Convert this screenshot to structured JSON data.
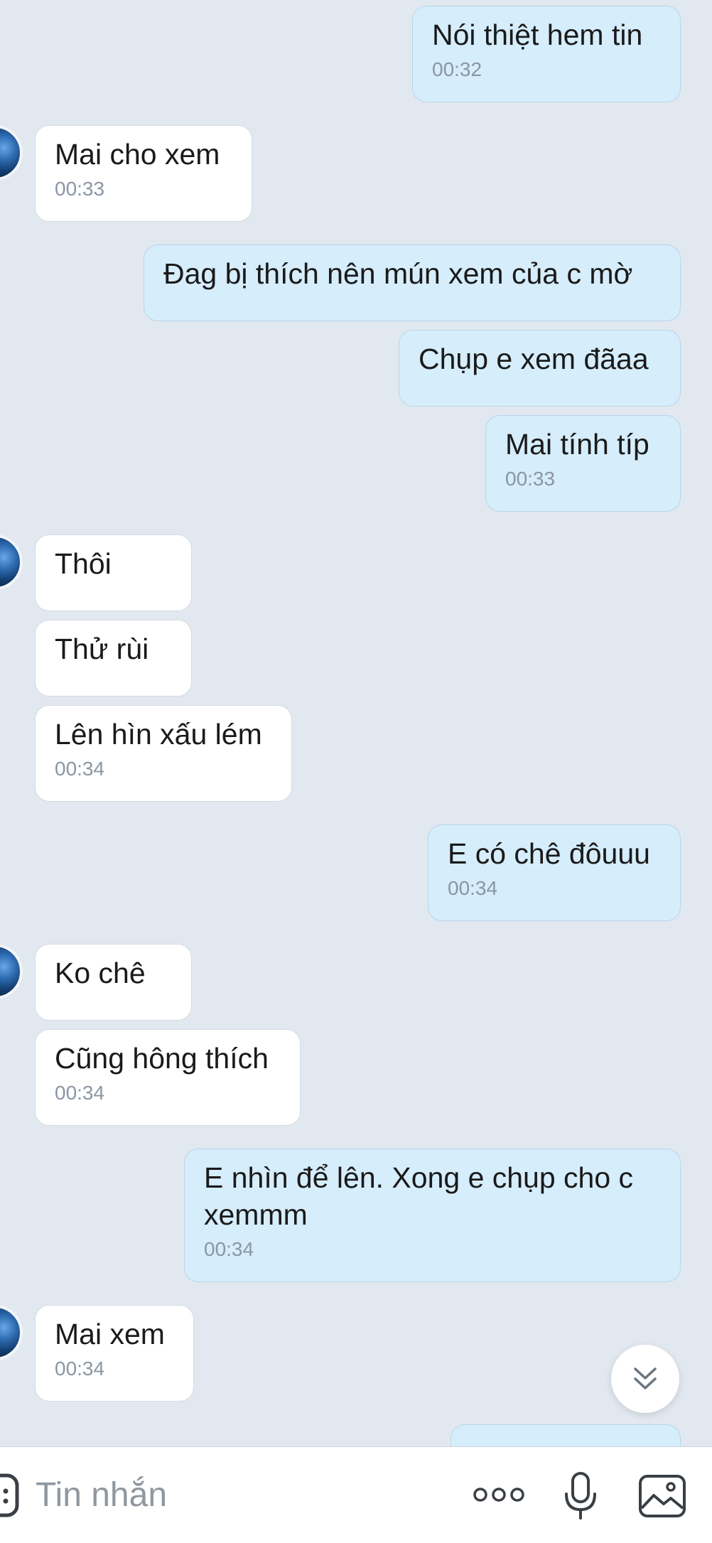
{
  "messages": [
    {
      "dir": "out",
      "text": "Nói thiệt hem tin",
      "time": "00:32"
    },
    {
      "dir": "in",
      "text": "Mai cho xem",
      "time": "00:33"
    },
    {
      "dir": "out",
      "text": "Đag bị thích nên mún xem của c mờ",
      "time": ""
    },
    {
      "dir": "out",
      "text": "Chụp e xem đãaa",
      "time": ""
    },
    {
      "dir": "out",
      "text": "Mai tính típ",
      "time": "00:33"
    },
    {
      "dir": "in",
      "text": "Thôi",
      "time": ""
    },
    {
      "dir": "in",
      "text": "Thử rùi",
      "time": ""
    },
    {
      "dir": "in",
      "text": "Lên hìn xấu lém",
      "time": "00:34"
    },
    {
      "dir": "out",
      "text": "E có chê đôuuu",
      "time": "00:34"
    },
    {
      "dir": "in",
      "text": "Ko chê",
      "time": ""
    },
    {
      "dir": "in",
      "text": "Cũng hông thích",
      "time": "00:34"
    },
    {
      "dir": "out",
      "text": "E nhìn để lên. Xong e chụp cho c xemmm",
      "time": "00:34"
    },
    {
      "dir": "in",
      "text": "Mai xem",
      "time": "00:34"
    },
    {
      "dir": "out",
      "text": "",
      "time": ""
    }
  ],
  "input": {
    "placeholder": "Tin nhắn"
  },
  "icons": {
    "sticker": "sticker-icon",
    "more": "more-options-icon",
    "mic": "microphone-icon",
    "gallery": "image-gallery-icon",
    "scroll": "scroll-to-bottom-icon",
    "avatar": "contact-avatar"
  },
  "colors": {
    "background": "#e2e8f0",
    "incoming_bubble": "#ffffff",
    "outgoing_bubble": "#d6edfb",
    "timestamp": "#8a96a3",
    "placeholder": "#8f979f"
  }
}
